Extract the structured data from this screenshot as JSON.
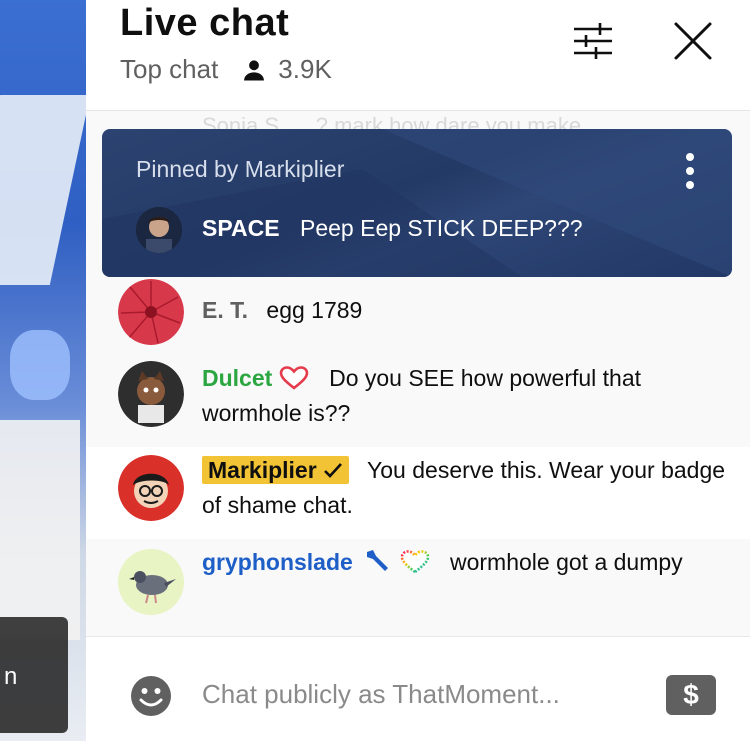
{
  "header": {
    "title": "Live chat",
    "mode": "Top chat",
    "viewer_count": "3.9K"
  },
  "faded_preview": "Sonia S. . . ? mark how dare you make",
  "pinned": {
    "label": "Pinned by Markiplier",
    "author": "SPACE",
    "text": "Peep Eep STICK DEEP???"
  },
  "messages": [
    {
      "author": "E. T.",
      "text": "egg 1789"
    },
    {
      "author": "Dulcet",
      "text": "Do you SEE how powerful that wormhole is??"
    },
    {
      "author": "Markiplier",
      "text": "You deserve this. Wear your badge of shame chat."
    },
    {
      "author": "gryphonslade",
      "text": "wormhole got a dumpy"
    }
  ],
  "input": {
    "placeholder": "Chat publicly as ThatMoment..."
  },
  "video": {
    "button_text": "n"
  },
  "colors": {
    "pinned_bg": "#243a66",
    "owner_badge": "#f2c335",
    "member_green": "#2ba640",
    "moderator_blue": "#1d5ec7"
  },
  "icons": [
    "person-icon",
    "filter-icon",
    "close-icon",
    "kebab-icon",
    "heart-icon",
    "checkmark-icon",
    "wrench-icon",
    "emoji-icon",
    "dollar-icon"
  ]
}
